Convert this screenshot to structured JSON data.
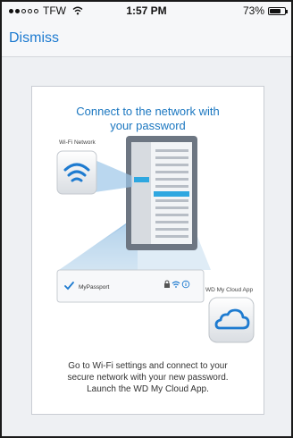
{
  "status_bar": {
    "carrier": "TFW",
    "time": "1:57 PM",
    "battery_percent": "73%",
    "battery_level": 0.73,
    "signal_bars_filled": 2,
    "signal_bars_total": 5
  },
  "nav": {
    "dismiss_label": "Dismiss"
  },
  "card": {
    "title_line1": "Connect to the network with",
    "title_line2": "your password",
    "wifi_network_label": "Wi-Fi Network",
    "network_row_name": "MyPassport",
    "app_label": "WD My Cloud App",
    "description_line1": "Go to Wi-Fi settings and connect to your",
    "description_line2": "secure network with your new password.",
    "description_line3": "Launch the WD My Cloud App."
  },
  "colors": {
    "accent": "#1e7bd0",
    "title_blue": "#1b77c0",
    "beam_blue": "#a9cdea",
    "tablet_frame": "#6d7682"
  }
}
